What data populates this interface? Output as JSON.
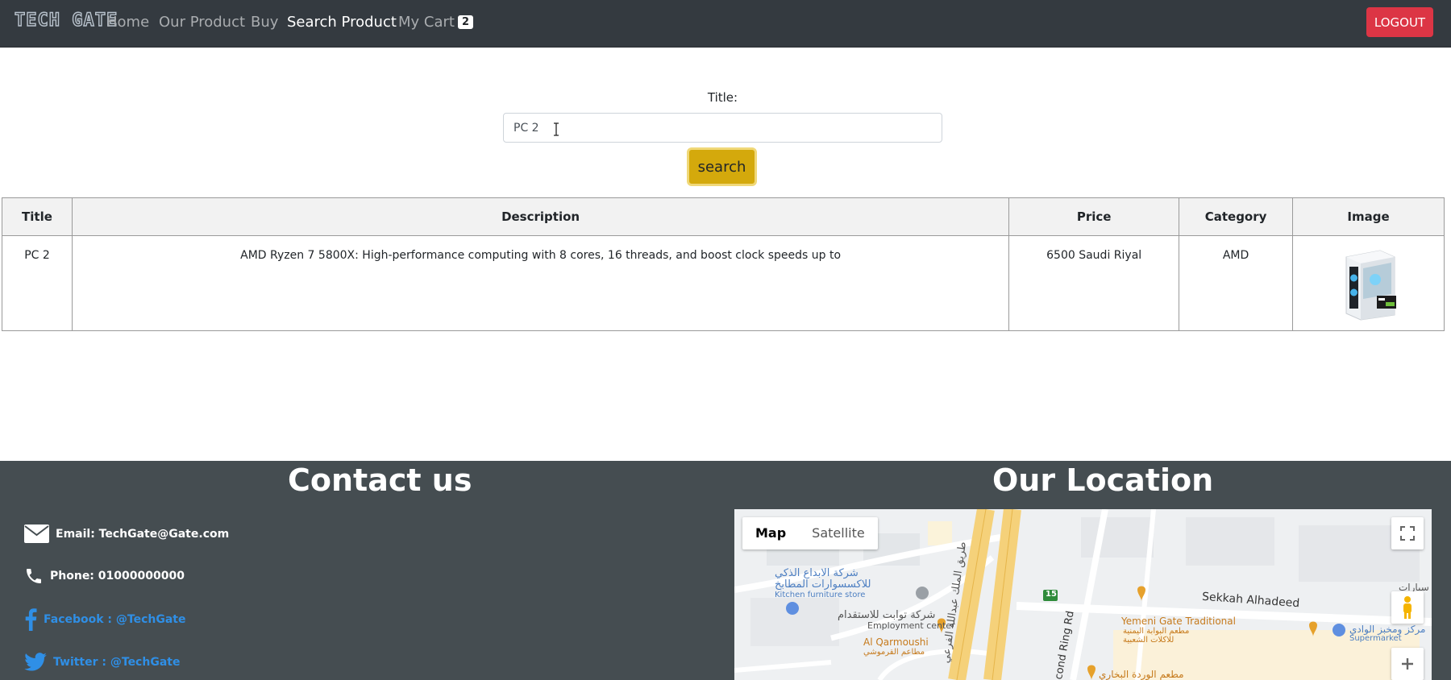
{
  "nav": {
    "brand": "TECH GATE",
    "links": [
      {
        "label": "Home"
      },
      {
        "label": "Our Product"
      },
      {
        "label": "Buy"
      },
      {
        "label": "Search Product"
      },
      {
        "label": "My Cart"
      }
    ],
    "cart_count": "2",
    "logout_label": "LOGOUT"
  },
  "search": {
    "title_label": "Title:",
    "title_value": "PC 2",
    "button_label": "search"
  },
  "table": {
    "headers": [
      "Title",
      "Description",
      "Price",
      "Category",
      "Image"
    ],
    "rows": [
      {
        "title": "PC 2",
        "description": "AMD Ryzen 7 5800X: High-performance computing with 8 cores, 16 threads, and boost clock speeds up to",
        "price": "6500 Saudi Riyal",
        "category": "AMD"
      }
    ]
  },
  "footer": {
    "contact_title": "Contact us",
    "location_title": "Our Location",
    "email": "Email: TechGate@Gate.com",
    "phone": "Phone: 01000000000",
    "facebook": "Facebook : @TechGate",
    "twitter": "Twitter : @TechGate"
  },
  "map": {
    "tab_map": "Map",
    "tab_satellite": "Satellite",
    "labels": {
      "innovation_ar": "شركة الابداع الذكي",
      "kitchen_ar": "للاكسسوارات المطابخ",
      "kitchen_en": "Kitchen furniture store",
      "employment_ar": "شركة توابت للاستقدام",
      "employment_en": "Employment center",
      "qarmoushi": "Al Qarmoushi",
      "qarmoushi_ar": "مطاعم القرموشي",
      "king_road_ar": "طريق الملك عبدالله الفرعي",
      "ring_rd": "cond Ring Rd",
      "sekkah": "Sekkah Alhadeed",
      "yemeni": "Yemeni Gate Traditional",
      "yemeni_ar1": "مطعم البوابة اليمنية",
      "yemeni_ar2": "للاكلات الشعبية",
      "supermarket_ar": "مركز ومخبز الوادي",
      "supermarket_en": "Supermarket",
      "cars_ar": "سيارات",
      "rose_ar": "مطعم الوردة البخاري",
      "route": "15"
    }
  }
}
